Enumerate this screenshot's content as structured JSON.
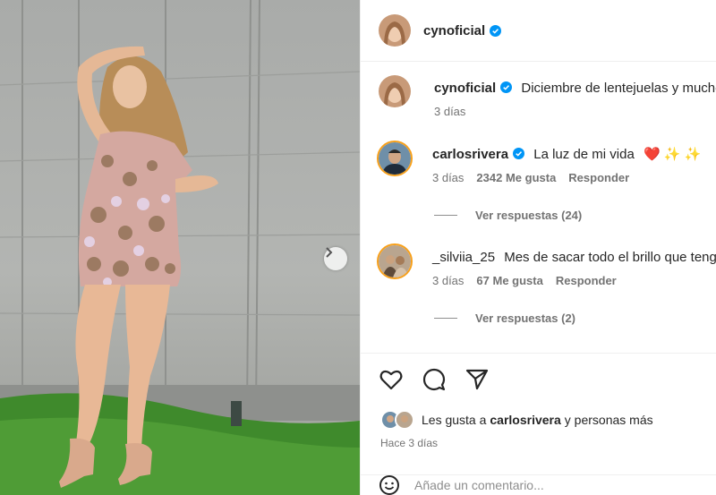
{
  "post": {
    "author": "cynoficial",
    "caption": "Diciembre de lentejuelas y mucho brillo",
    "caption_time": "3 días"
  },
  "comments": [
    {
      "user": "carlosrivera",
      "verified": true,
      "text": "La luz de mi vida",
      "emoji": "❤️ ✨ ✨",
      "time": "3 días",
      "likes": "2342 Me gusta",
      "reply_label": "Responder",
      "view_replies": "Ver respuestas (24)"
    },
    {
      "user": "_silviia_25",
      "verified": false,
      "text": "Mes de sacar todo el brillo que tengo",
      "time": "3 días",
      "likes": "67 Me gusta",
      "reply_label": "Responder",
      "view_replies": "Ver respuestas (2)"
    }
  ],
  "likes_line": {
    "prefix": "Les gusta a",
    "user": "carlosrivera",
    "suffix": "y personas más"
  },
  "posted_ago": "Hace 3 días",
  "add_comment_placeholder": "Añade un comentario...",
  "icons": {
    "like": "heart-icon",
    "comment": "comment-icon",
    "share": "send-icon",
    "emoji": "emoji-icon",
    "next": "chevron-right-icon",
    "verified": "verified-badge-icon"
  },
  "colors": {
    "verified": "#0095f6",
    "text": "#262626",
    "muted": "#737373",
    "heart": "#e0245e",
    "sparkle": "#f5c518"
  }
}
